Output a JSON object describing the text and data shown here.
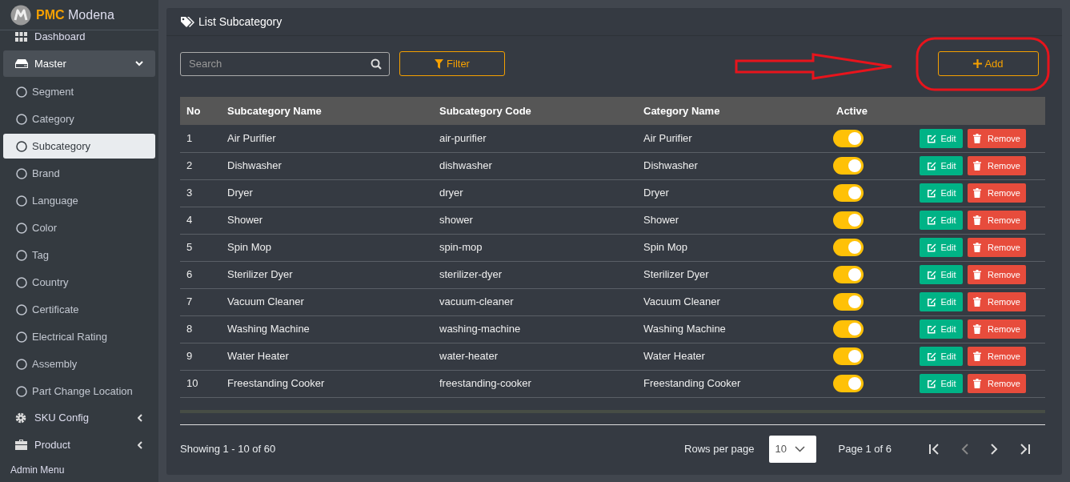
{
  "brand": {
    "highlight": "PMC",
    "name": "Modena"
  },
  "sidebar": {
    "items": [
      {
        "label": "Dashboard",
        "expanded": false
      },
      {
        "label": "Master",
        "expanded": true,
        "children": [
          {
            "label": "Segment",
            "selected": false
          },
          {
            "label": "Category",
            "selected": false
          },
          {
            "label": "Subcategory",
            "selected": true
          },
          {
            "label": "Brand",
            "selected": false
          },
          {
            "label": "Language",
            "selected": false
          },
          {
            "label": "Color",
            "selected": false
          },
          {
            "label": "Tag",
            "selected": false
          },
          {
            "label": "Country",
            "selected": false
          },
          {
            "label": "Certificate",
            "selected": false
          },
          {
            "label": "Electrical Rating",
            "selected": false
          },
          {
            "label": "Assembly",
            "selected": false
          },
          {
            "label": "Part Change Location",
            "selected": false
          }
        ]
      },
      {
        "label": "SKU Config",
        "expanded": false
      },
      {
        "label": "Product",
        "expanded": false
      }
    ],
    "section_heading": "Admin Menu"
  },
  "page": {
    "title": "List Subcategory",
    "search": {
      "placeholder": "Search"
    },
    "filter_button": "Filter",
    "add_button": "Add"
  },
  "table": {
    "columns": [
      "No",
      "Subcategory Name",
      "Subcategory Code",
      "Category Name",
      "Active"
    ],
    "rows": [
      {
        "no": "1",
        "name": "Air Purifier",
        "code": "air-purifier",
        "category": "Air Purifier",
        "active": true,
        "edit": "Edit",
        "remove": "Remove"
      },
      {
        "no": "2",
        "name": "Dishwasher",
        "code": "dishwasher",
        "category": "Dishwasher",
        "active": true,
        "edit": "Edit",
        "remove": "Remove"
      },
      {
        "no": "3",
        "name": "Dryer",
        "code": "dryer",
        "category": "Dryer",
        "active": true,
        "edit": "Edit",
        "remove": "Remove"
      },
      {
        "no": "4",
        "name": "Shower",
        "code": "shower",
        "category": "Shower",
        "active": true,
        "edit": "Edit",
        "remove": "Remove"
      },
      {
        "no": "5",
        "name": "Spin Mop",
        "code": "spin-mop",
        "category": "Spin Mop",
        "active": true,
        "edit": "Edit",
        "remove": "Remove"
      },
      {
        "no": "6",
        "name": "Sterilizer Dyer",
        "code": "sterilizer-dyer",
        "category": "Sterilizer Dyer",
        "active": true,
        "edit": "Edit",
        "remove": "Remove"
      },
      {
        "no": "7",
        "name": "Vacuum Cleaner",
        "code": "vacuum-cleaner",
        "category": "Vacuum Cleaner",
        "active": true,
        "edit": "Edit",
        "remove": "Remove"
      },
      {
        "no": "8",
        "name": "Washing Machine",
        "code": "washing-machine",
        "category": "Washing Machine",
        "active": true,
        "edit": "Edit",
        "remove": "Remove"
      },
      {
        "no": "9",
        "name": "Water Heater",
        "code": "water-heater",
        "category": "Water Heater",
        "active": true,
        "edit": "Edit",
        "remove": "Remove"
      },
      {
        "no": "10",
        "name": "Freestanding Cooker",
        "code": "freestanding-cooker",
        "category": "Freestanding Cooker",
        "active": true,
        "edit": "Edit",
        "remove": "Remove"
      }
    ]
  },
  "pagination": {
    "showing": "Showing 1 - 10 of 60",
    "rows_per_page_label": "Rows per page",
    "rows_per_page": "10",
    "page": "Page 1 of 6"
  }
}
